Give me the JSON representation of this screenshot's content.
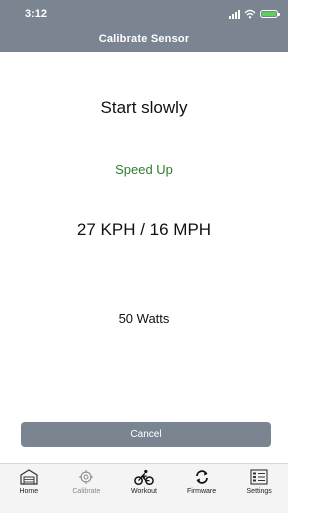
{
  "status_bar": {
    "time": "3:12"
  },
  "nav": {
    "title": "Calibrate Sensor"
  },
  "content": {
    "instruction": "Start slowly",
    "phase": "Speed Up",
    "speed": "27 KPH / 16 MPH",
    "power": "50 Watts"
  },
  "actions": {
    "cancel_label": "Cancel"
  },
  "tabs": [
    {
      "label": "Home",
      "icon": "garage-icon"
    },
    {
      "label": "Calibrate",
      "icon": "crosshair-icon"
    },
    {
      "label": "Workout",
      "icon": "bike-rider-icon"
    },
    {
      "label": "Firmware",
      "icon": "sync-arrows-icon"
    },
    {
      "label": "Settings",
      "icon": "settings-list-icon"
    }
  ],
  "colors": {
    "header_bg": "#7b8591",
    "phase_text": "#2e7d2e",
    "battery_fill": "#5bd35b"
  }
}
